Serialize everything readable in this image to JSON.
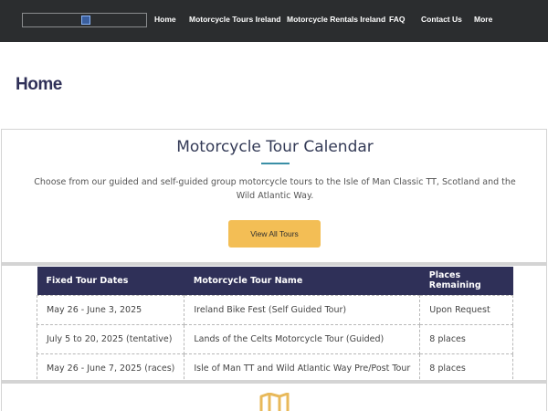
{
  "nav": {
    "logo_icon": "broken-image-icon",
    "items": [
      "Home",
      "Motorcycle Tours Ireland",
      "Motorcycle Rentals Ireland",
      "FAQ",
      "Contact Us",
      "More"
    ]
  },
  "page": {
    "title": "Home"
  },
  "calendar": {
    "title": "Motorcycle Tour Calendar",
    "description": "Choose from our guided and self-guided group motorcycle tours to the Isle of Man Classic TT, Scotland and the Wild Atlantic Way.",
    "button_label": "View All Tours"
  },
  "table": {
    "headers": [
      "Fixed Tour Dates",
      "Motorcycle Tour Name",
      "Places Remaining"
    ],
    "rows": [
      [
        "May 26 - June 3, 2025",
        "Ireland Bike Fest (Self Guided Tour)",
        "Upon Request"
      ],
      [
        "July 5 to 20, 2025 (tentative)",
        "Lands of the Celts Motorcycle Tour (Guided)",
        "8 places"
      ],
      [
        "May 26 - June 7, 2025 (races)",
        "Isle of Man TT and Wild Atlantic Way Pre/Post Tour",
        "8 places"
      ]
    ]
  },
  "footer_icon": "map-icon",
  "colors": {
    "topbar": "#2b2d2f",
    "heading": "#2f3058",
    "accent_rule": "#3a8fa6",
    "button": "#f3be55",
    "table_header": "#2f3058",
    "map_icon": "#e8b95a"
  }
}
